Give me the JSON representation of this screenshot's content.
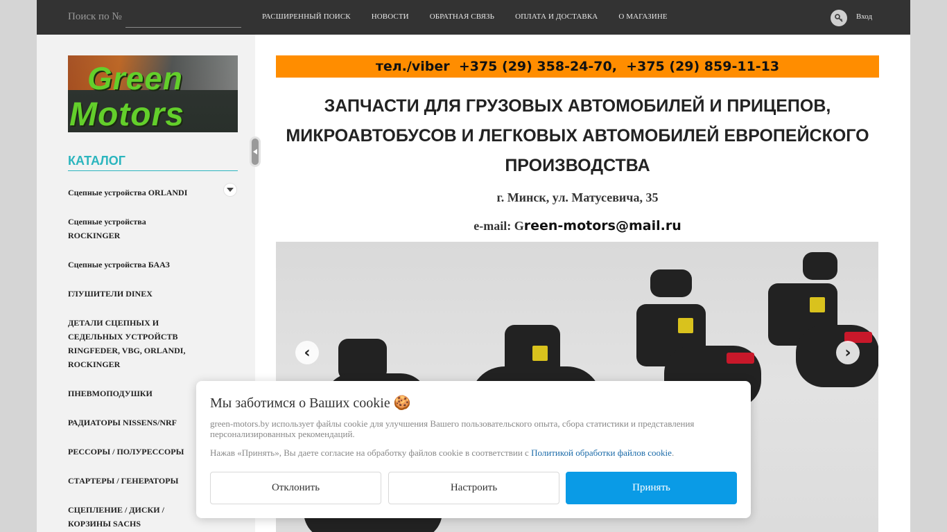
{
  "topbar": {
    "search_label": "Поиск по №",
    "search_value": "",
    "nav": [
      "РАСШИРЕННЫЙ ПОИСК",
      "НОВОСТИ",
      "ОБРАТНАЯ СВЯЗЬ",
      "ОПЛАТА И ДОСТАВКА",
      "О МАГАЗИНЕ"
    ],
    "login_label": "Вход",
    "login_icon": "key-icon"
  },
  "sidebar": {
    "logo_line1": "Green",
    "logo_line2": "Motors",
    "catalog_title": "КАТАЛОГ",
    "items": [
      "Сцепные устройства ORLANDI",
      "Сцепные устройства ROCKINGER",
      "Сцепные устройства БААЗ",
      "ГЛУШИТЕЛИ DINEX",
      "ДЕТАЛИ СЦЕПНЫХ И СЕДЕЛЬНЫХ УСТРОЙСТВ RINGFEDER, VBG, ORLANDI, ROCKINGER",
      "ПНЕВМОПОДУШКИ",
      "РАДИАТОРЫ NISSENS/NRF",
      "РЕССОРЫ / ПОЛУРЕССОРЫ",
      "СТАРТЕРЫ / ГЕНЕРАТОРЫ",
      "СЦЕПЛЕНИЕ / ДИСКИ / КОРЗИНЫ SACHS"
    ]
  },
  "main": {
    "phone_bar": "тел./viber  +375 (29) 358-24-70,  +375 (29) 859-11-13",
    "heading": "ЗАПЧАСТИ ДЛЯ ГРУЗОВЫХ АВТОМОБИЛЕЙ И ПРИЦЕПОВ, МИКРОАВТОБУСОВ И ЛЕГКОВЫХ АВТОМОБИЛЕЙ ЕВРОПЕЙСКОГО ПРОИЗВОДСТВА",
    "address": "г. Минск, ул. Матусевича, 35",
    "email_prefix": "e-mail: G",
    "email_rest": "reen-motors@mail.ru",
    "slider_prev": "‹",
    "slider_next": "›"
  },
  "cookie": {
    "title": "Мы заботимся о Ваших cookie 🍪",
    "text": "green-motors.by использует файлы cookie для улучшения Вашего пользовательского опыта, сбора статистики и представления персонализированных рекомендаций.",
    "consent_prefix": "Нажав «Принять», Вы даете согласие на обработку файлов cookie в соответствии с ",
    "consent_link": "Политикой обработки файлов cookie",
    "consent_suffix": ".",
    "decline": "Отклонить",
    "configure": "Настроить",
    "accept": "Принять"
  },
  "colors": {
    "topbar": "#333333",
    "accent_teal": "#2bb5be",
    "phone_bar": "#ff8d00",
    "accept_button": "#0a9be6"
  }
}
